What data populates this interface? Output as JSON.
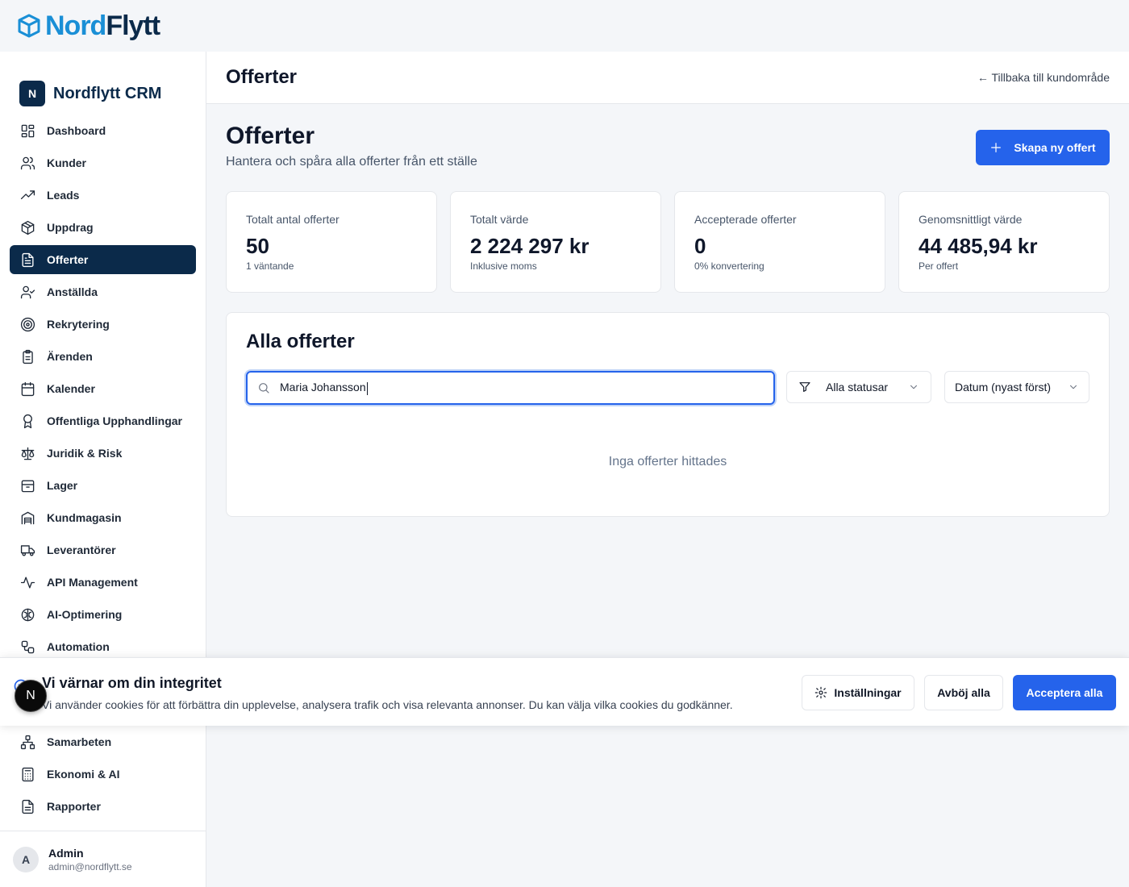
{
  "brand": {
    "nord": "Nord",
    "flytt": "Flytt"
  },
  "sidebar": {
    "logo_letter": "N",
    "title": "Nordflytt CRM",
    "items": [
      {
        "label": "Dashboard",
        "icon": "layout-grid-icon"
      },
      {
        "label": "Kunder",
        "icon": "users-icon"
      },
      {
        "label": "Leads",
        "icon": "trending-up-icon"
      },
      {
        "label": "Uppdrag",
        "icon": "package-icon"
      },
      {
        "label": "Offerter",
        "icon": "file-text-icon",
        "active": true
      },
      {
        "label": "Anställda",
        "icon": "user-check-icon"
      },
      {
        "label": "Rekrytering",
        "icon": "target-icon"
      },
      {
        "label": "Ärenden",
        "icon": "clipboard-icon"
      },
      {
        "label": "Kalender",
        "icon": "calendar-icon"
      },
      {
        "label": "Offentliga Upphandlingar",
        "icon": "award-icon"
      },
      {
        "label": "Juridik & Risk",
        "icon": "scale-icon"
      },
      {
        "label": "Lager",
        "icon": "archive-icon"
      },
      {
        "label": "Kundmagasin",
        "icon": "warehouse-icon"
      },
      {
        "label": "Leverantörer",
        "icon": "truck-icon"
      },
      {
        "label": "API Management",
        "icon": "activity-icon"
      },
      {
        "label": "AI-Optimering",
        "icon": "brain-icon"
      },
      {
        "label": "Automation",
        "icon": "workflow-icon"
      }
    ],
    "bottom_items": [
      {
        "label": "Samarbeten",
        "icon": "network-icon"
      },
      {
        "label": "Ekonomi & AI",
        "icon": "calculator-icon"
      },
      {
        "label": "Rapporter",
        "icon": "file-report-icon"
      }
    ],
    "user": {
      "initial": "A",
      "name": "Admin",
      "email": "admin@nordflytt.se"
    }
  },
  "header": {
    "title": "Offerter",
    "back_link": "← Tillbaka till kundområde"
  },
  "page": {
    "title": "Offerter",
    "subtitle": "Hantera och spåra alla offerter från ett ställe",
    "create_button": "Skapa ny offert"
  },
  "stats": [
    {
      "label": "Totalt antal offerter",
      "value": "50",
      "sub": "1 väntande"
    },
    {
      "label": "Totalt värde",
      "value": "2 224 297 kr",
      "sub": "Inklusive moms"
    },
    {
      "label": "Accepterade offerter",
      "value": "0",
      "sub": "0% konvertering"
    },
    {
      "label": "Genomsnittligt värde",
      "value": "44 485,94 kr",
      "sub": "Per offert"
    }
  ],
  "list": {
    "title": "Alla offerter",
    "search_value": "Maria Johansson",
    "status_filter": "Alla statusar",
    "sort": "Datum (nyast först)",
    "empty_text": "Inga offerter hittades"
  },
  "cookie": {
    "title": "Vi värnar om din integritet",
    "text": "Vi använder cookies för att förbättra din upplevelse, analysera trafik och visa relevanta annonser. Du kan välja vilka cookies du godkänner.",
    "settings": "Inställningar",
    "reject": "Avböj alla",
    "accept": "Acceptera alla"
  },
  "bubble": {
    "letter": "N"
  },
  "colors": {
    "primary": "#2563eb",
    "navy": "#0b2a4a",
    "brand_blue": "#1a8fd6"
  }
}
